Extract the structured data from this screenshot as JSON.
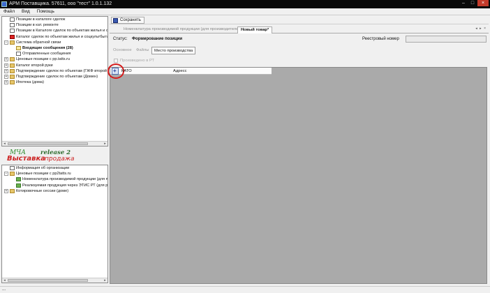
{
  "window": {
    "title": "АРМ Поставщика. 57611, ооо \"тест\" 1.0.1.132"
  },
  "menu": [
    "Файл",
    "Вид",
    "Помощь"
  ],
  "tree_top": [
    {
      "label": "Позиции в каталоге сделок",
      "indent": 0,
      "icon": "document-icon",
      "exp": ""
    },
    {
      "label": "Позиции в кат. ремонте",
      "indent": 0,
      "icon": "document-icon",
      "exp": ""
    },
    {
      "label": "Позиции в Каталоге сделок по объектам жилья и со",
      "indent": 0,
      "icon": "document-icon",
      "exp": ""
    },
    {
      "label": "Каталог сделок по объектам жилья и соцкультбыта",
      "indent": 0,
      "icon": "red-document-icon",
      "exp": ""
    },
    {
      "label": "Система обратной связи",
      "indent": 0,
      "icon": "folder-icon",
      "exp": "−"
    },
    {
      "label": "Входящие сообщения (28)",
      "indent": 1,
      "icon": "envelope-icon",
      "exp": "",
      "bold": true
    },
    {
      "label": "Отправленные сообщения",
      "indent": 1,
      "icon": "document-icon",
      "exp": ""
    },
    {
      "label": "Ценовые позиции с pp.tatts.ru",
      "indent": 0,
      "icon": "folder-icon",
      "exp": "+"
    },
    {
      "label": "Каталог второй руки",
      "indent": 0,
      "icon": "folder-icon",
      "exp": "+"
    },
    {
      "label": "Подтверждение сделок по объектам (ГЖФ второй",
      "indent": 0,
      "icon": "folder-icon",
      "exp": "+"
    },
    {
      "label": "Подтверждение сделок по объектам (Домен)",
      "indent": 0,
      "icon": "folder-icon",
      "exp": "+"
    },
    {
      "label": "Ипотека (дома)",
      "indent": 0,
      "icon": "folder-icon",
      "exp": "+"
    }
  ],
  "tree_bottom": [
    {
      "label": "Информация об организации",
      "indent": 0,
      "icon": "document-icon",
      "exp": ""
    },
    {
      "label": "Ценовые позиции с pp2tatts.ru",
      "indent": 0,
      "icon": "folder-icon",
      "exp": "−"
    },
    {
      "label": "Номенклатура производимой продукции (для прс",
      "indent": 1,
      "icon": "green-item-icon",
      "exp": ""
    },
    {
      "label": "Реализуемая продукция через ЭТИС РТ (для реа",
      "indent": 1,
      "icon": "green-item-icon",
      "exp": ""
    },
    {
      "label": "Котировочные сессии (доме)",
      "indent": 0,
      "icon": "folder-icon",
      "exp": "+"
    }
  ],
  "logo": {
    "line1": "МЧА",
    "line2": "Выставка",
    "line3": "release 2",
    "line4": "продажа"
  },
  "toolbar": {
    "save_label": "Сохранить"
  },
  "doc_tabs": [
    {
      "label": "Номенклатура производимой продукции (для производителей)",
      "active": false
    },
    {
      "label": "Новый товар*",
      "active": true
    }
  ],
  "tab_controls": "◂ ▸ ×",
  "status": {
    "label": "Статус:",
    "value": "Формирование позиции",
    "registry_label": "Реестровый номер",
    "registry_value": ""
  },
  "sub_tabs": [
    {
      "label": "Основное",
      "active": false
    },
    {
      "label": "Файлы",
      "active": false
    },
    {
      "label": "Место производства",
      "active": true
    }
  ],
  "checkbox": {
    "label": "Произведено в РТ",
    "checked": false
  },
  "grid": {
    "columns": [
      "КАТО",
      "Адресс"
    ],
    "add_icon": "+"
  },
  "statusbar": {
    "text": "..."
  },
  "colors": {
    "highlight_circle": "#d61b1b",
    "grid_background": "#aaaaaa",
    "titlebar": "#0a0a0a"
  }
}
